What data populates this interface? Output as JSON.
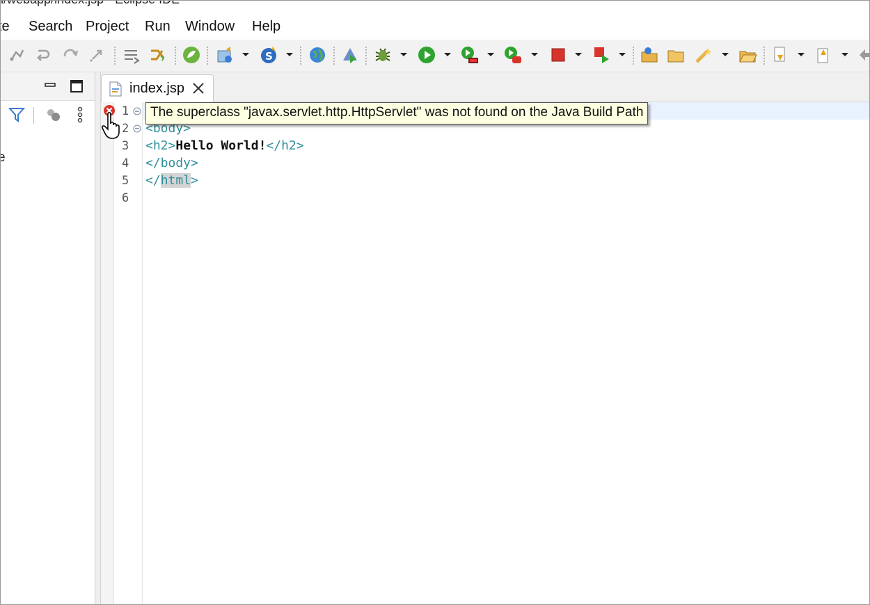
{
  "window": {
    "title": "n/webapp/index.jsp - Eclipse IDE"
  },
  "menu": {
    "items": [
      "te",
      "Search",
      "Project",
      "Run",
      "Window",
      "Help"
    ]
  },
  "toolbar": {
    "icons": [
      "connect-icon",
      "step-return-icon",
      "redo-icon",
      "drop-to-frame-icon",
      "step-filter-icon",
      "merge-icon",
      "spring-icon",
      "new-server-icon",
      "spring-boot-icon",
      "globe-icon",
      "deploy-icon",
      "debug-icon",
      "run-icon",
      "run-coverage-icon",
      "profile-icon",
      "stop-icon",
      "stop-run-icon",
      "open-task-icon",
      "open-folder-icon",
      "wand-icon",
      "open-file-icon",
      "next-annotation-icon",
      "previous-annotation-icon"
    ]
  },
  "left_view": {
    "lines": [
      "e",
      "."
    ]
  },
  "editor": {
    "tab": {
      "label": "index.jsp"
    },
    "line_numbers": [
      "1",
      "2",
      "3",
      "4",
      "5",
      "6"
    ],
    "lines": {
      "l2": "<body>",
      "l3_open": "<h2>",
      "l3_text": "Hello World!",
      "l3_close": "</h2>",
      "l4": "</body>",
      "l5_a": "</",
      "l5_b": "html",
      "l5_c": ">"
    },
    "error_tooltip": "The superclass \"javax.servlet.http.HttpServlet\" was not found on the Java Build Path"
  },
  "colors": {
    "tag": "#2f8f9b",
    "current_line": "#e8f2fe",
    "tooltip_bg": "#ffffe1",
    "error": "#d9342b"
  }
}
